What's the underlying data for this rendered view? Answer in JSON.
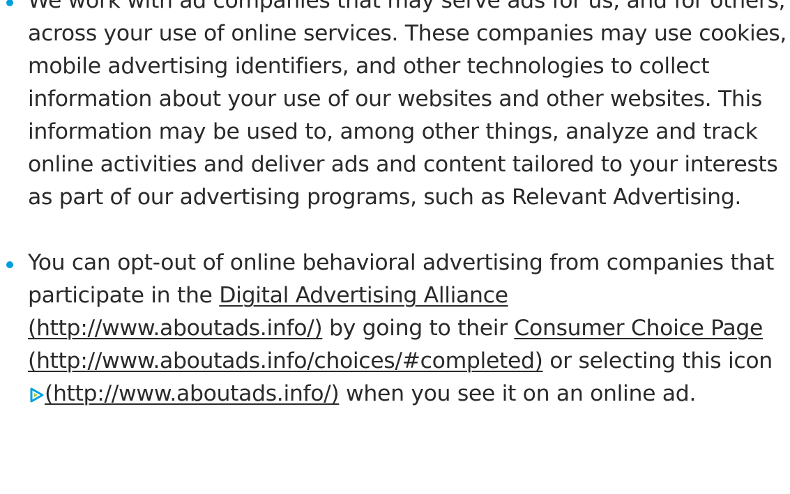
{
  "bullets": {
    "first": {
      "text": "We work with ad companies that may serve ads for us, and for others, across your use of online services. These companies may use cookies, mobile advertising identifiers, and other technologies to collect information about your use of our websites and other websites. This information may be used to, among other things, analyze and track online activities and deliver ads and content tailored to your interests as part of our advertising programs, such as Relevant Advertising."
    },
    "second": {
      "text_before": "You can opt-out of online behavioral advertising from companies that participate in the ",
      "link_daa": "Digital Advertising Alliance (http://www.aboutads.info/)",
      "text_middle": " by going to their ",
      "link_choices": "Consumer Choice Page (http://www.aboutads.info/choices/#completed)",
      "text_or": " or selecting this icon ",
      "link_icon": "(http://www.aboutads.info/)",
      "text_after": " when you see it on an online ad."
    }
  },
  "colors": {
    "bullet": "#009fdb",
    "text": "#2a2a2a",
    "icon_primary": "#00a0df",
    "icon_secondary": "#9ccc3c"
  },
  "icons": {
    "adchoices": "adchoices-icon"
  }
}
